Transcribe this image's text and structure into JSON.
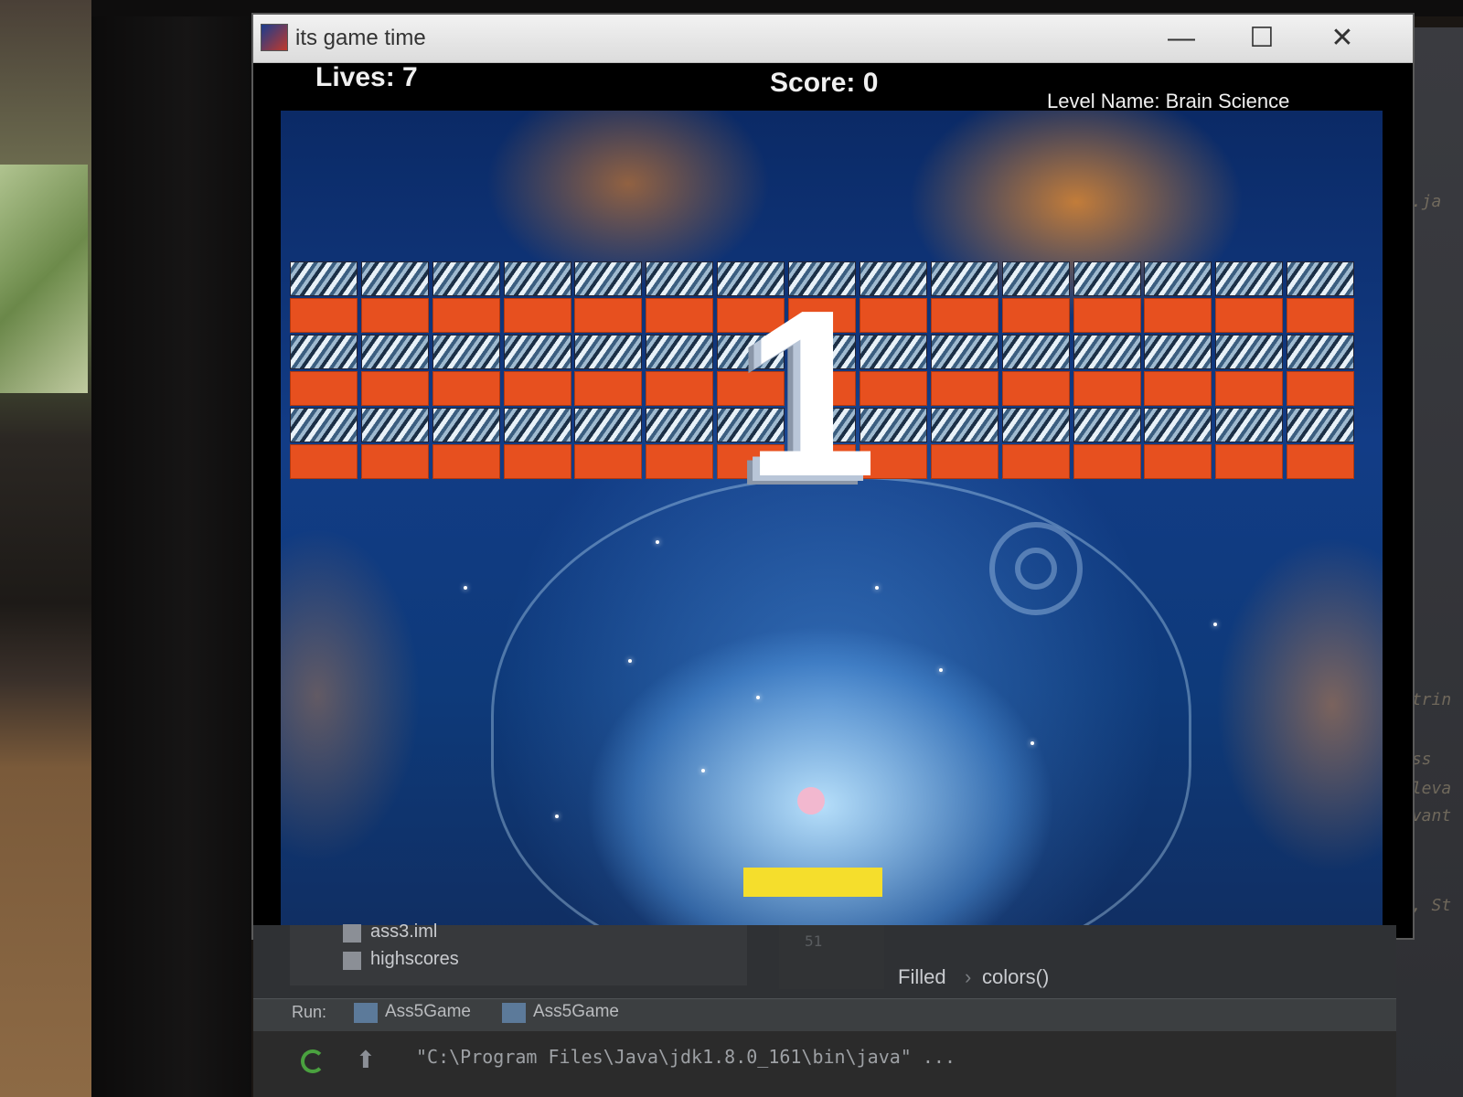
{
  "window": {
    "title": "its game time",
    "controls": {
      "minimize": "—",
      "maximize": "☐",
      "close": "✕"
    }
  },
  "hud": {
    "lives": "Lives: 7",
    "score": "Score: 0",
    "level": "Level Name: Brain Science"
  },
  "game": {
    "countdown": "1",
    "brick_columns": 15,
    "brick_rows": [
      "image",
      "orange",
      "image",
      "orange",
      "image",
      "orange"
    ],
    "colors": {
      "brick_orange": "#e7501f",
      "paddle": "#f5de2c",
      "ball": "#f2b8cf"
    }
  },
  "ide": {
    "project_files": [
      "ass3.iml",
      "highscores"
    ],
    "line_number": "51",
    "breadcrumb": [
      "Filled",
      "colors()"
    ],
    "breadcrumb_sep": "›",
    "run_label": "Run:",
    "run_tabs": [
      "Ass5Game",
      "Ass5Game"
    ],
    "console_cmd": "\"C:\\Program Files\\Java\\jdk1.8.0_161\\bin\\java\" ...",
    "side_fragments": [
      "e.ja",
      "strin",
      "ess",
      "eleva",
      "evant",
      "s, St"
    ]
  }
}
